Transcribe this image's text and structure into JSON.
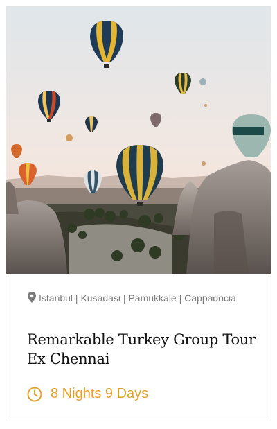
{
  "card": {
    "image_alt": "Hot air balloons over Cappadocia rock formations",
    "location": "Istanbul | Kusadasi | Pamukkale | Cappadocia",
    "title": "Remarkable Turkey Group Tour Ex Chennai",
    "duration": "8 Nights 9 Days",
    "icons": {
      "location": "map-pin-icon",
      "duration": "clock-icon"
    },
    "colors": {
      "accent": "#e5a02a",
      "location_text": "#7a7a7a",
      "title_text": "#111111"
    }
  }
}
